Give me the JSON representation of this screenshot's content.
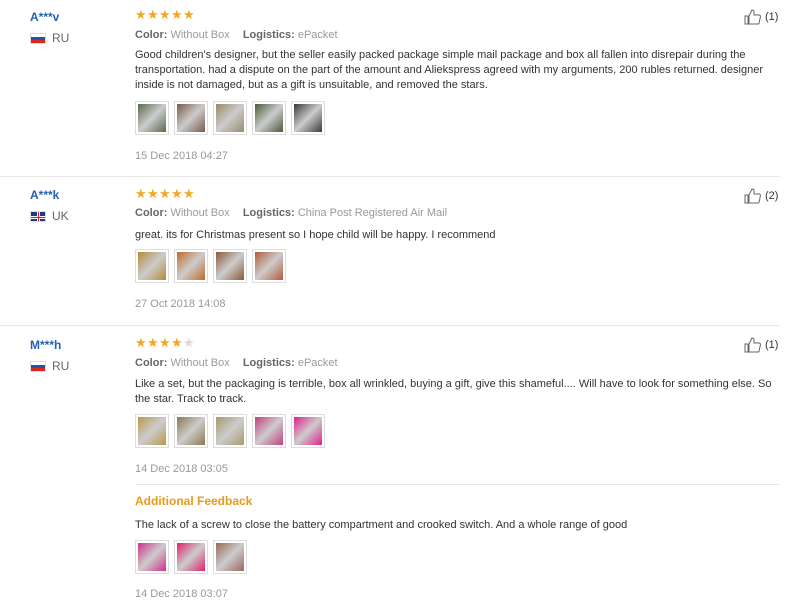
{
  "reviews": [
    {
      "user": "A***v",
      "country": "RU",
      "flag": "flag-ru",
      "rating": 5,
      "color_label": "Color:",
      "color_value": "Without Box",
      "logistics_label": "Logistics:",
      "logistics_value": "ePacket",
      "text": "Good children's designer, but the seller easily packed package simple mail package and box all fallen into disrepair during the transportation. had a dispute on the part of the amount and Aliekspress agreed with my arguments, 200 rubles returned. designer inside is not damaged, but as a gift is unsuitable, and removed the stars.",
      "photos": [
        "#5a6b4a",
        "#7a5a4a",
        "#9a8a6a",
        "#4a5a3a",
        "#3a3a3a"
      ],
      "date": "15 Dec 2018 04:27",
      "helpful": "(1)"
    },
    {
      "user": "A***k",
      "country": "UK",
      "flag": "flag-uk",
      "rating": 5,
      "color_label": "Color:",
      "color_value": "Without Box",
      "logistics_label": "Logistics:",
      "logistics_value": "China Post Registered Air Mail",
      "text": "great. its for Christmas present so I hope child will be happy. I recommend",
      "photos": [
        "#b58a3a",
        "#c06a2a",
        "#8a5a3a",
        "#b55a3a"
      ],
      "date": "27 Oct 2018 14:08",
      "helpful": "(2)"
    },
    {
      "user": "M***h",
      "country": "RU",
      "flag": "flag-ru",
      "rating": 4,
      "color_label": "Color:",
      "color_value": "Without Box",
      "logistics_label": "Logistics:",
      "logistics_value": "ePacket",
      "text": "Like a set, but the packaging is terrible, box all wrinkled, buying a gift, give this shameful.... Will have to look for something else. So the star. Track to track.",
      "photos": [
        "#b89a4a",
        "#8a7a4a",
        "#a89a6a",
        "#c0407a",
        "#e0208a"
      ],
      "date": "14 Dec 2018 03:05",
      "helpful": "(1)",
      "additional": {
        "title": "Additional Feedback",
        "text": "The lack of a screw to close the battery compartment and crooked switch. And a whole range of good",
        "photos": [
          "#d0308a",
          "#e0206a",
          "#9a6a5a"
        ],
        "date": "14 Dec 2018 03:07"
      }
    }
  ]
}
